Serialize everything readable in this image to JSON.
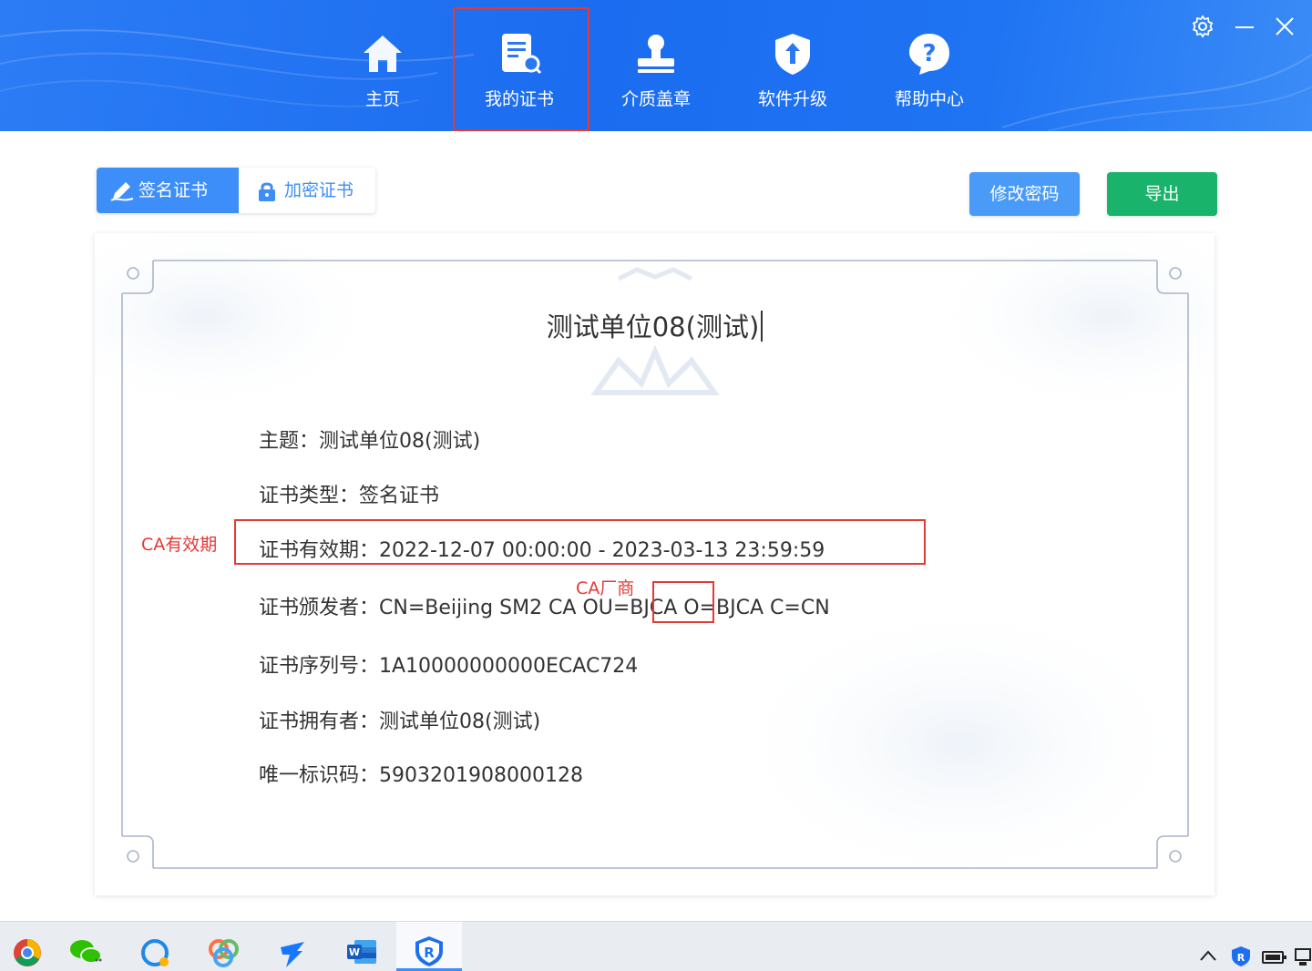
{
  "window": {
    "nav": [
      {
        "label": "主页",
        "icon": "home-icon"
      },
      {
        "label": "我的证书",
        "icon": "certificate-search-icon",
        "selected": true
      },
      {
        "label": "介质盖章",
        "icon": "stamp-icon"
      },
      {
        "label": "软件升级",
        "icon": "shield-upgrade-icon"
      },
      {
        "label": "帮助中心",
        "icon": "help-icon"
      }
    ],
    "controls": [
      "gear-icon",
      "minimize-icon",
      "close-icon"
    ]
  },
  "tabs": {
    "sign": {
      "label": "签名证书",
      "icon": "pen-icon",
      "active": true
    },
    "encrypt": {
      "label": "加密证书",
      "icon": "lock-icon",
      "active": false
    }
  },
  "actions": {
    "change_password": "修改密码",
    "export": "导出"
  },
  "certificate": {
    "title": "测试单位08(测试)",
    "subject": "主题：测试单位08(测试)",
    "type": "证书类型：签名证书",
    "validity": "证书有效期：2022-12-07 00:00:00 - 2023-03-13 23:59:59",
    "issuer": "证书颁发者：CN=Beijing SM2 CA OU=BJCA O=BJCA C=CN",
    "serial": "证书序列号：1A10000000000ECAC724",
    "owner": "证书拥有者：测试单位08(测试)",
    "unique_id": "唯一标识码：5903201908000128"
  },
  "annotations": {
    "validity_note": "CA有效期",
    "vendor_note": "CA厂商"
  },
  "colors": {
    "header": "#1b6cf0",
    "accent": "#3d8ef8",
    "export": "#19b36b",
    "annotation": "#e53935"
  },
  "taskbar": {
    "apps": [
      "chrome-icon",
      "wechat-icon",
      "chat-bubble-icon",
      "colorful-app-icon",
      "dingtalk-icon",
      "word-icon",
      "shield-r-icon"
    ],
    "tray": [
      "chevron-up-icon",
      "shield-r-tray-icon",
      "battery-icon",
      "network-icon"
    ]
  }
}
